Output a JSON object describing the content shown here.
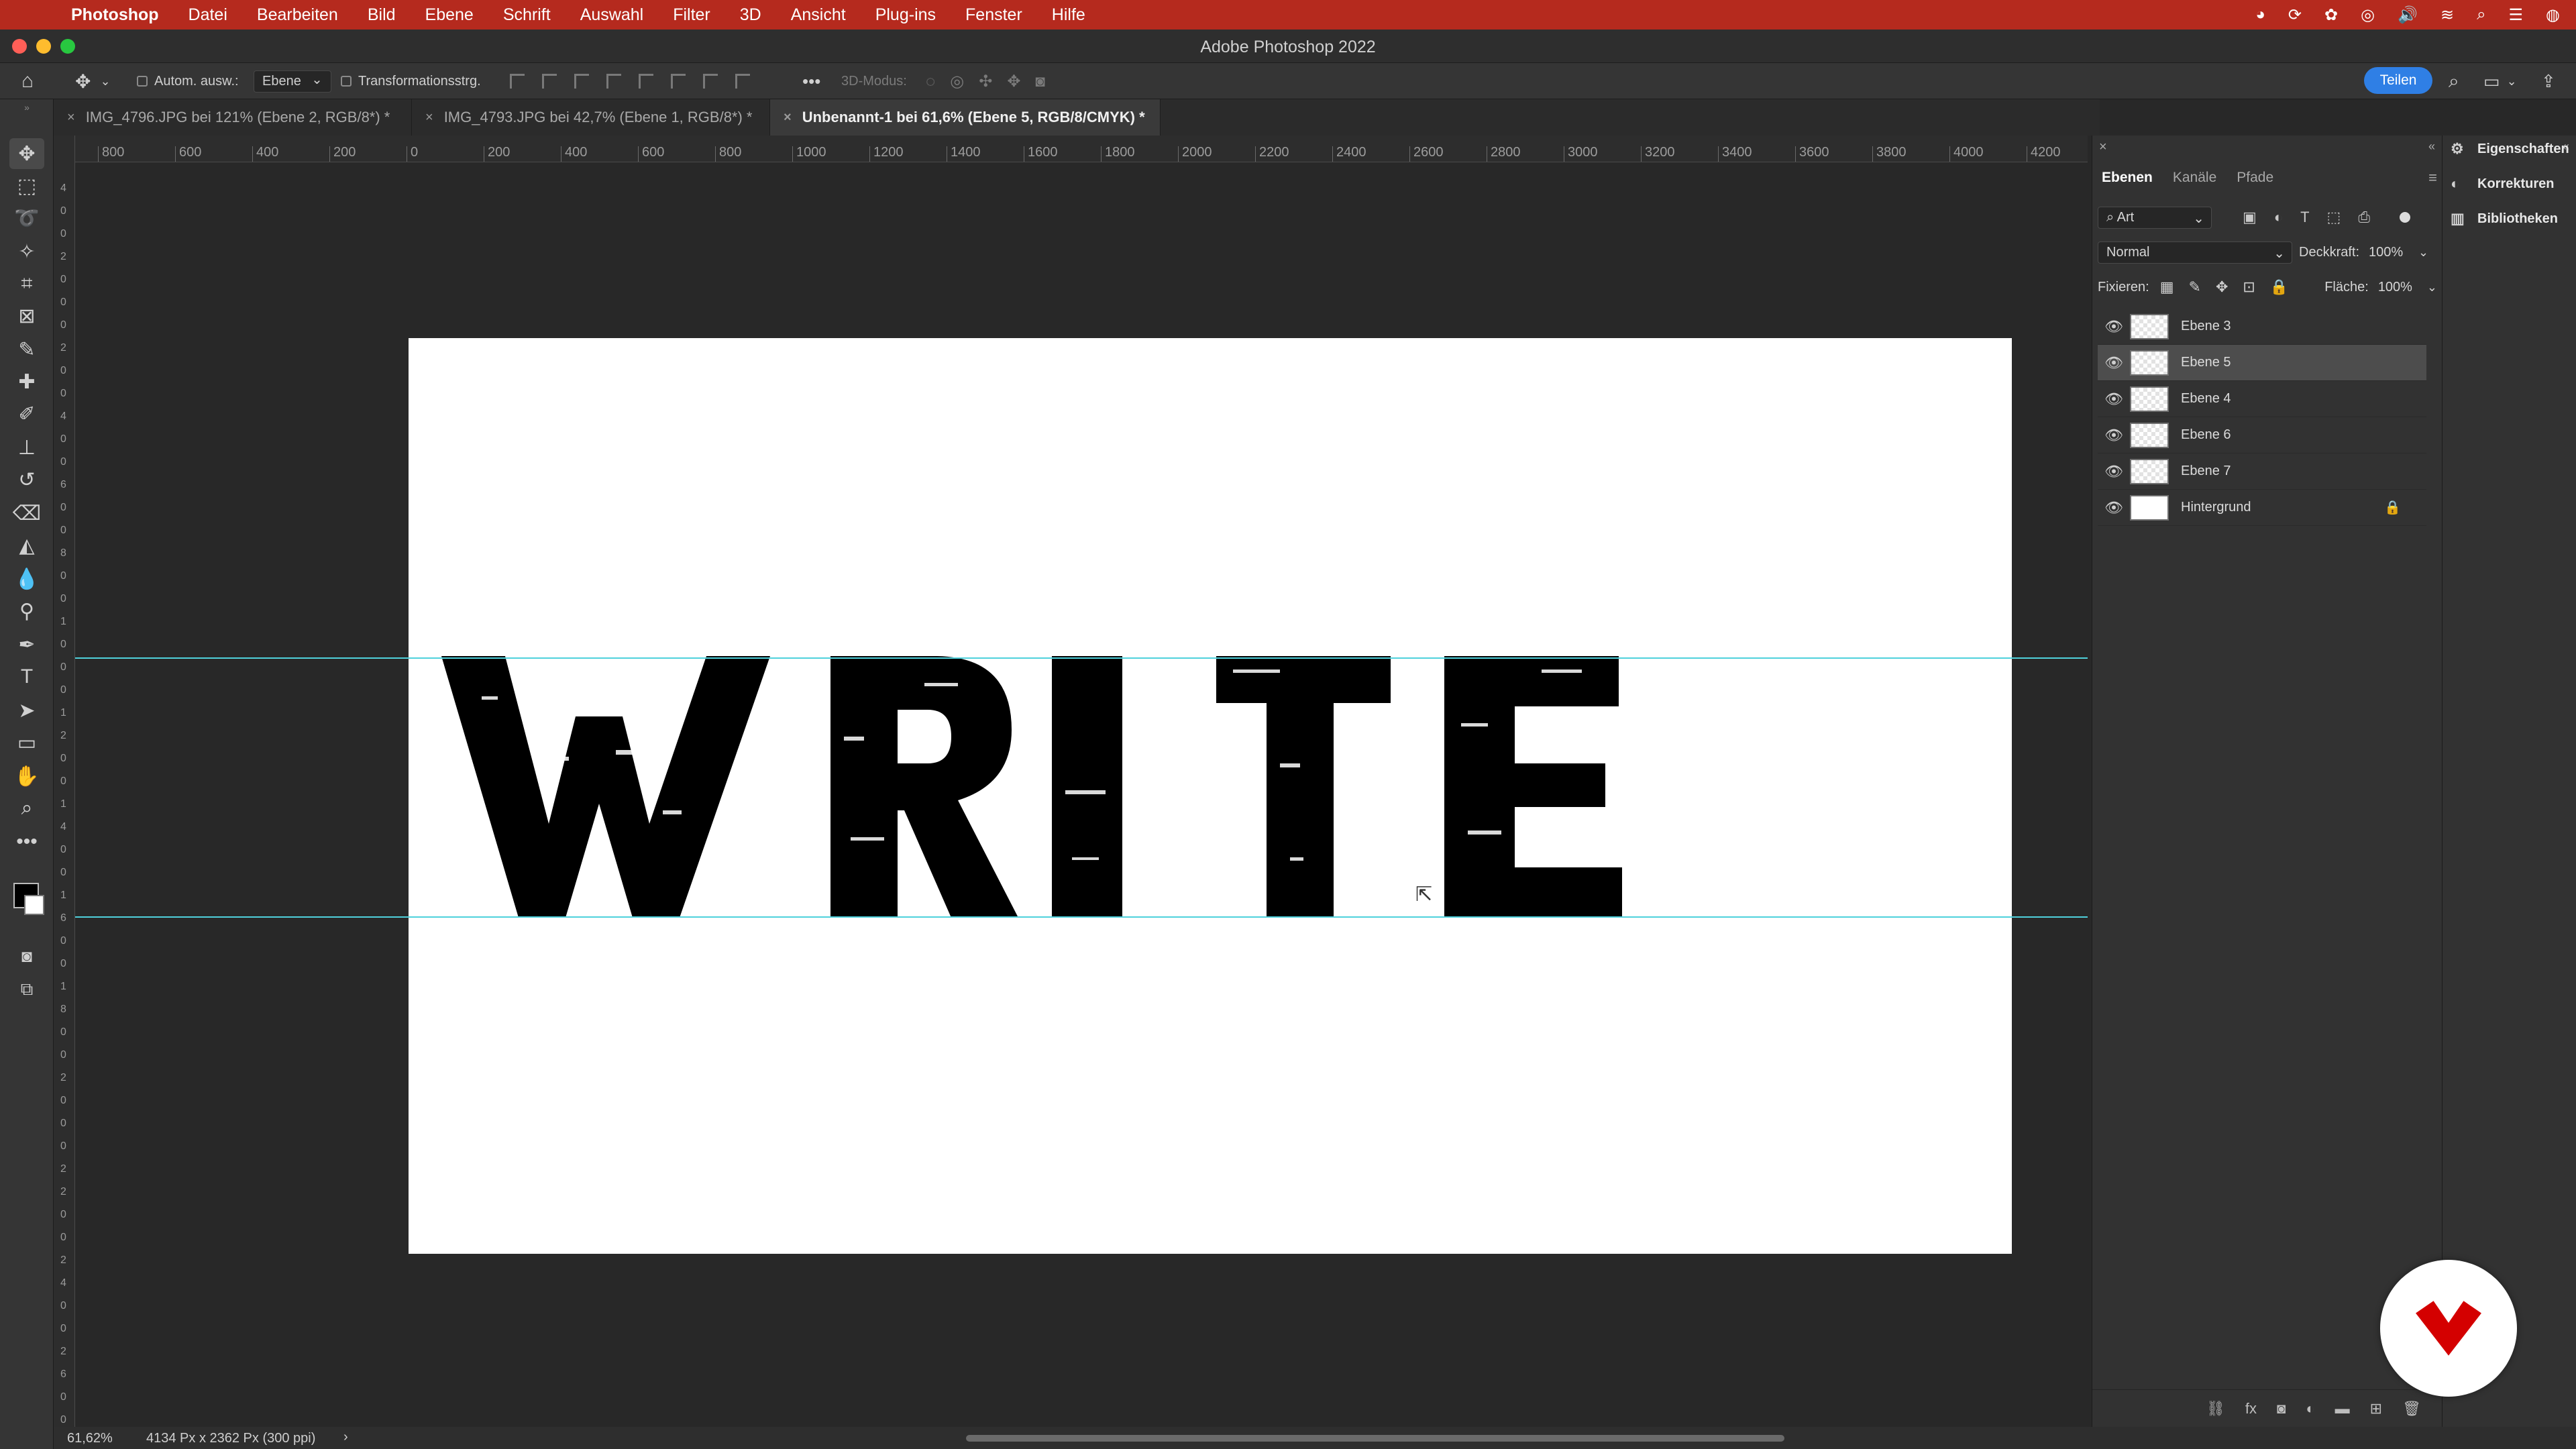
{
  "menubar": {
    "app_name": "Photoshop",
    "items": [
      "Datei",
      "Bearbeiten",
      "Bild",
      "Ebene",
      "Schrift",
      "Auswahl",
      "Filter",
      "3D",
      "Ansicht",
      "Plug-ins",
      "Fenster",
      "Hilfe"
    ]
  },
  "window": {
    "title": "Adobe Photoshop 2022"
  },
  "options_bar": {
    "auto_select_label": "Autom. ausw.:",
    "auto_select_value": "Ebene",
    "transform_label": "Transformationsstrg.",
    "mode_3d_label": "3D-Modus:",
    "share_button": "Teilen"
  },
  "tabs": [
    {
      "label": "IMG_4796.JPG bei 121% (Ebene 2, RGB/8*) *",
      "active": false
    },
    {
      "label": "IMG_4793.JPG bei 42,7% (Ebene 1, RGB/8*) *",
      "active": false
    },
    {
      "label": "Unbenannt-1 bei 61,6% (Ebene 5, RGB/8/CMYK) *",
      "active": true
    }
  ],
  "ruler": {
    "h_labels": [
      "800",
      "600",
      "400",
      "200",
      "0",
      "200",
      "400",
      "600",
      "800",
      "1000",
      "1200",
      "1400",
      "1600",
      "1800",
      "2000",
      "2200",
      "2400",
      "2600",
      "2800",
      "3000",
      "3200",
      "3400",
      "3600",
      "3800",
      "4000",
      "4200"
    ],
    "v_labels": [
      "4",
      "0",
      "0",
      "2",
      "0",
      "0",
      "0",
      "2",
      "0",
      "0",
      "4",
      "0",
      "0",
      "6",
      "0",
      "0",
      "8",
      "0",
      "0",
      "1",
      "0",
      "0",
      "0",
      "1",
      "2",
      "0",
      "0",
      "1",
      "4",
      "0",
      "0",
      "1",
      "6",
      "0",
      "0",
      "1",
      "8",
      "0",
      "0",
      "2",
      "0",
      "0",
      "0",
      "2",
      "2",
      "0",
      "0",
      "2",
      "4",
      "0",
      "0",
      "2",
      "6",
      "0",
      "0"
    ]
  },
  "canvas": {
    "text": "WRITE"
  },
  "layers_panel": {
    "tabs": [
      "Ebenen",
      "Kanäle",
      "Pfade"
    ],
    "filter_label": "Art",
    "blend_mode": "Normal",
    "opacity_label": "Deckkraft:",
    "opacity_value": "100%",
    "lock_label": "Fixieren:",
    "fill_label": "Fläche:",
    "fill_value": "100%",
    "layers": [
      {
        "name": "Ebene 3",
        "visible": true,
        "selected": false,
        "locked": false
      },
      {
        "name": "Ebene 5",
        "visible": true,
        "selected": true,
        "locked": false
      },
      {
        "name": "Ebene 4",
        "visible": true,
        "selected": false,
        "locked": false
      },
      {
        "name": "Ebene 6",
        "visible": true,
        "selected": false,
        "locked": false
      },
      {
        "name": "Ebene 7",
        "visible": true,
        "selected": false,
        "locked": false
      },
      {
        "name": "Hintergrund",
        "visible": true,
        "selected": false,
        "locked": true
      }
    ]
  },
  "side_panel": {
    "items": [
      "Eigenschaften",
      "Korrekturen",
      "Bibliotheken"
    ]
  },
  "status": {
    "zoom": "61,62%",
    "doc_size": "4134 Px x 2362 Px (300 ppi)"
  },
  "colors": {
    "menubar": "#b52a1e",
    "guide": "#4fd1dc",
    "share": "#2f7fe5",
    "logo": "#d40000"
  }
}
